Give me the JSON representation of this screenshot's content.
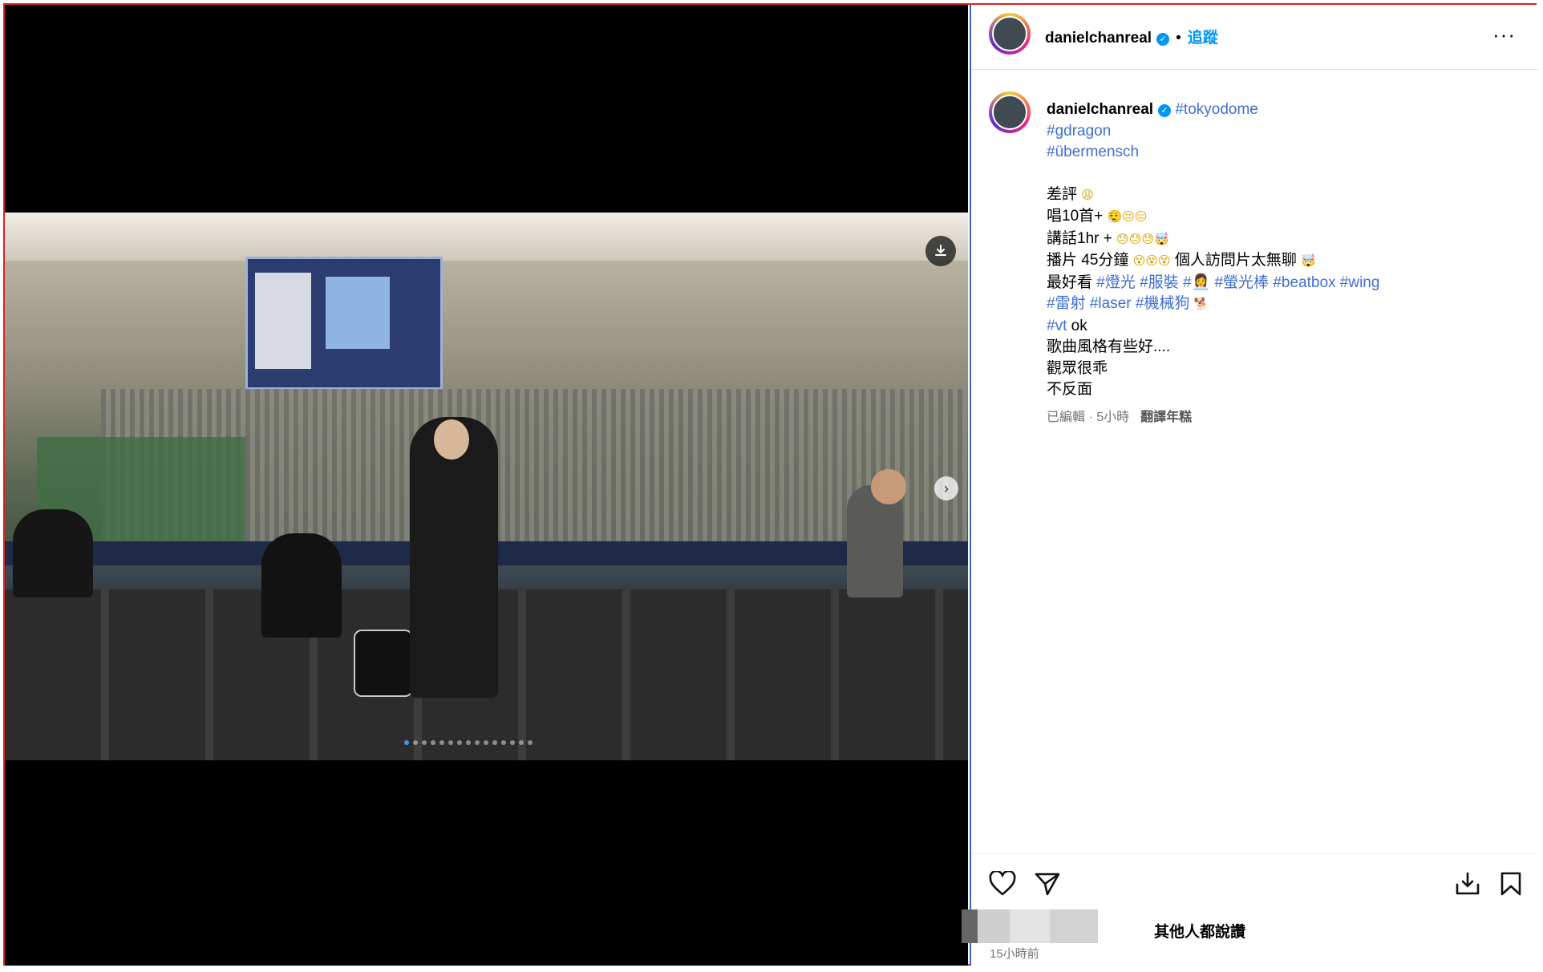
{
  "post": {
    "username": "danielchanreal",
    "verified_mark": "✓",
    "separator": "•",
    "follow_label": "追蹤",
    "more_label": "···"
  },
  "caption": {
    "username": "danielchanreal",
    "tag_tokyodome": "#tokyodome",
    "tag_gdragon": "#gdragon",
    "tag_ubermensch": "#übermensch",
    "line1_text": "差評",
    "line1_emoji": "😩",
    "line2_text": "唱10首+",
    "line2_emoji": "😮‍💨😐😑",
    "line3_text": "講話1hr +",
    "line3_emoji": "😓😓😓🤯",
    "line4_text_a": "播片 45分鐘",
    "line4_emoji_a": "😵😵😵",
    "line4_text_b": "個人訪問片太無聊",
    "line4_emoji_b": "🤯",
    "line5_text": "最好看",
    "line5_tags": "#燈光 #服裝 #👩‍💼 #螢光棒 #beatbox #wing",
    "line6_tags": "#雷射 #laser #機械狗",
    "line6_emoji": "🐕",
    "line7_tag": "#vt",
    "line7_text": "ok",
    "line8_text": "歌曲風格有些好....",
    "line9_text": "觀眾很乖",
    "line10_text": "不反面",
    "meta_edited": "已編輯 · 5小時",
    "meta_translate": "翻譯年糕"
  },
  "actions": {
    "like_icon": "heart-icon",
    "share_icon": "send-icon",
    "download_icon": "download-icon",
    "save_icon": "bookmark-icon"
  },
  "likes_text": "其他人都說讚",
  "post_time": "15小時前",
  "media": {
    "slide_index": 1,
    "slide_count": 15
  },
  "colors": {
    "accent": "#0095f6",
    "hashtag": "#3f6fd0",
    "frame": "#e02020"
  }
}
